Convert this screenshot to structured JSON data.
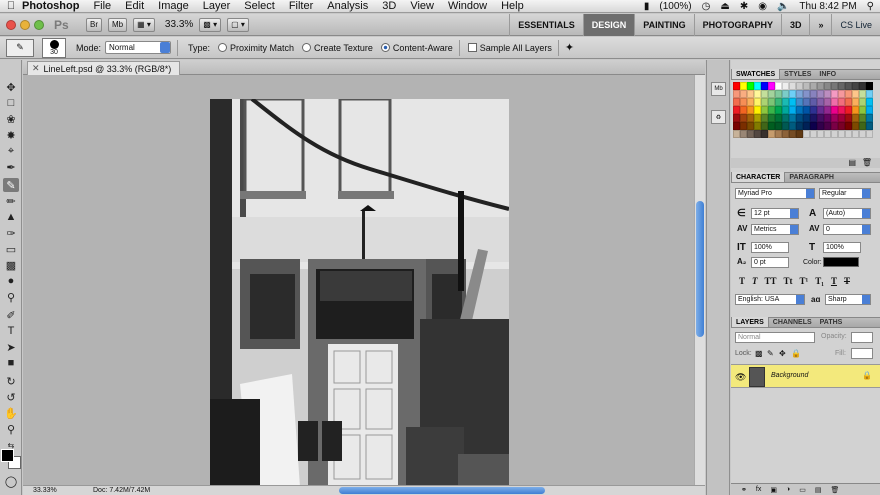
{
  "menubar": {
    "app_name": "Photoshop",
    "items": [
      "File",
      "Edit",
      "Image",
      "Layer",
      "Select",
      "Filter",
      "Analysis",
      "3D",
      "View",
      "Window",
      "Help"
    ],
    "battery": "(100%)",
    "clock": "Thu 8:42 PM"
  },
  "appbar": {
    "logo": "Ps",
    "bridge_label": "Br",
    "minibridge_label": "Mb",
    "zoom": "33.3%",
    "workspaces": [
      "ESSENTIALS",
      "DESIGN",
      "PAINTING",
      "PHOTOGRAPHY",
      "3D",
      "»"
    ],
    "active_workspace": "DESIGN",
    "cs_live": "CS Live"
  },
  "options": {
    "brush_size": "30",
    "mode_label": "Mode:",
    "mode_value": "Normal",
    "type_label": "Type:",
    "type_options": [
      "Proximity Match",
      "Create Texture",
      "Content-Aware"
    ],
    "type_selected": "Content-Aware",
    "sample_all_layers": "Sample All Layers"
  },
  "document": {
    "tab_title": "LineLeft.psd @ 33.3% (RGB/8*)",
    "status_zoom": "33.33%",
    "status_doc": "Doc: 7.42M/7.42M"
  },
  "panels": {
    "swatches_tabs": [
      "SWATCHES",
      "STYLES",
      "INFO"
    ],
    "character_tabs": [
      "CHARACTER",
      "PARAGRAPH"
    ],
    "font_family": "Myriad Pro",
    "font_style": "Regular",
    "font_size": "12 pt",
    "leading": "(Auto)",
    "kerning": "Metrics",
    "tracking": "0",
    "vscale": "100%",
    "hscale": "100%",
    "baseline": "0 pt",
    "color_label": "Color:",
    "language": "English: USA",
    "aa_label": "aɑ",
    "antialias": "Sharp",
    "layers_tabs": [
      "LAYERS",
      "CHANNELS",
      "PATHS"
    ],
    "blend_mode": "Normal",
    "opacity_label": "Opacity:",
    "lock_label": "Lock:",
    "fill_label": "Fill:",
    "layer_name": "Background"
  }
}
